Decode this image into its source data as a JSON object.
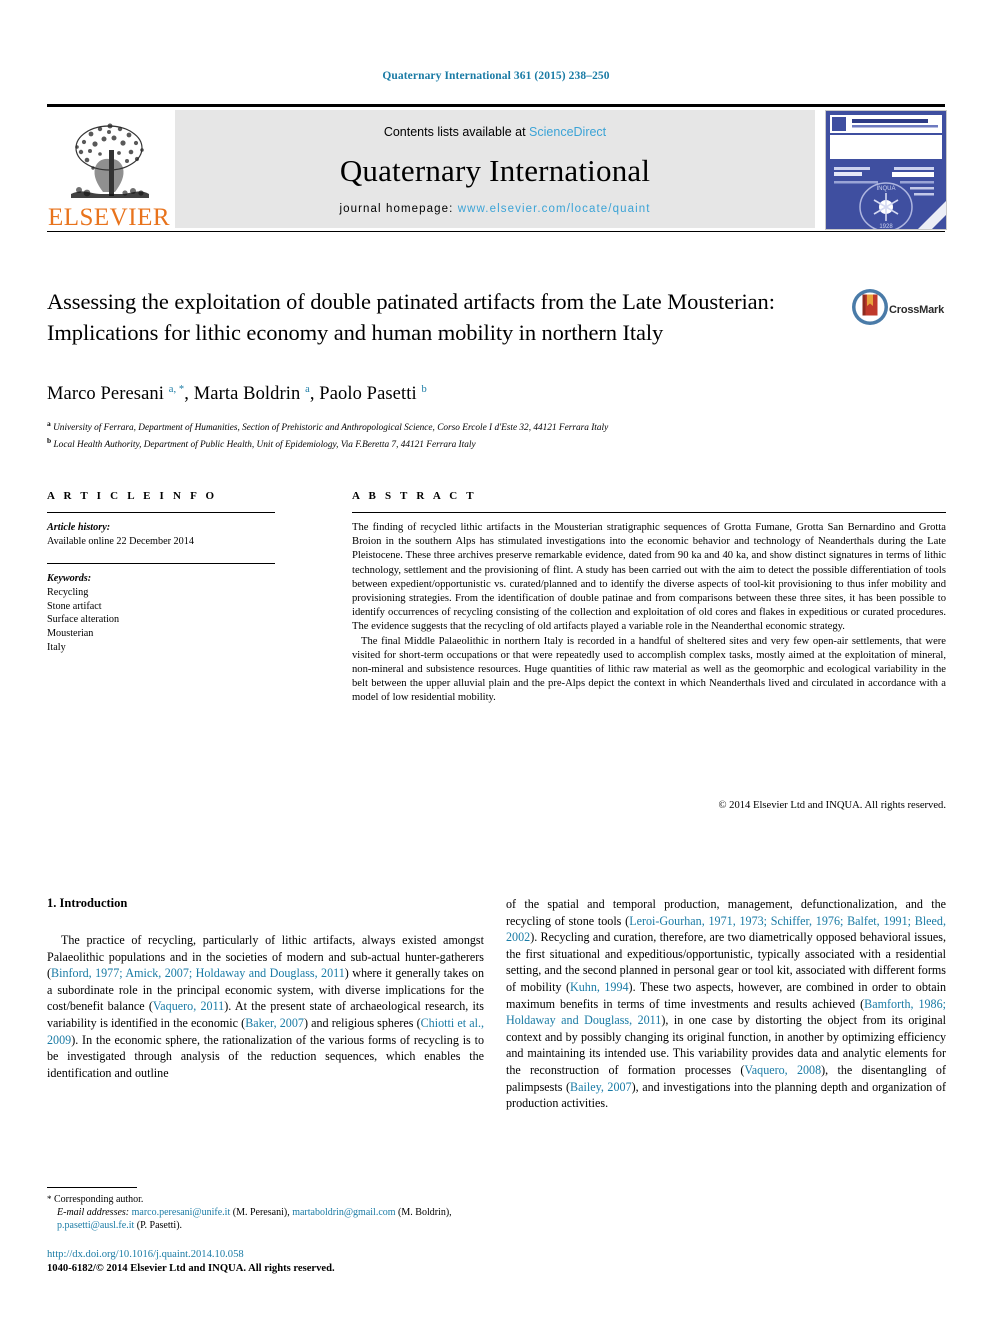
{
  "running_head": "Quaternary International 361 (2015) 238–250",
  "masthead": {
    "contents_prefix": "Contents lists available at ",
    "sciencedirect": "ScienceDirect",
    "journal_title": "Quaternary International",
    "homepage_prefix": "journal homepage: ",
    "homepage_url": "www.elsevier.com/locate/quaint",
    "publisher": "ELSEVIER",
    "accent_blue": "#3ba3d6",
    "elsevier_orange": "#e8731c",
    "cover_blue": "#3f4fa0"
  },
  "article": {
    "title": "Assessing the exploitation of double patinated artifacts from the Late Mousterian: Implications for lithic economy and human mobility in northern Italy",
    "crossmark_label": "CrossMark",
    "authors_html": "Marco Peresani <sup>a,&nbsp;*</sup>, Marta Boldrin <sup>a</sup>, Paolo Pasetti <sup>b</sup>",
    "affiliations": [
      {
        "marker": "a",
        "text": "University of Ferrara, Department of Humanities, Section of Prehistoric and Anthropological Science, Corso Ercole I d'Este 32, 44121 Ferrara Italy"
      },
      {
        "marker": "b",
        "text": "Local Health Authority, Department of Public Health, Unit of Epidemiology, Via F.Beretta 7, 44121 Ferrara Italy"
      }
    ]
  },
  "info": {
    "heading": "A R T I C L E   I N F O",
    "history_label": "Article history:",
    "history_value": "Available online 22 December 2014",
    "keywords_label": "Keywords:",
    "keywords": [
      "Recycling",
      "Stone artifact",
      "Surface alteration",
      "Mousterian",
      "Italy"
    ]
  },
  "abstract": {
    "heading": "A B S T R A C T",
    "paragraphs": [
      "The finding of recycled lithic artifacts in the Mousterian stratigraphic sequences of Grotta Fumane, Grotta San Bernardino and Grotta Broion in the southern Alps has stimulated investigations into the economic behavior and technology of Neanderthals during the Late Pleistocene. These three archives preserve remarkable evidence, dated from 90 ka and 40 ka, and show distinct signatures in terms of lithic technology, settlement and the provisioning of flint. A study has been carried out with the aim to detect the possible differentiation of tools between expedient/opportunistic vs. curated/planned and to identify the diverse aspects of tool-kit provisioning to thus infer mobility and provisioning strategies. From the identification of double patinae and from comparisons between these three sites, it has been possible to identify occurrences of recycling consisting of the collection and exploitation of old cores and flakes in expeditious or curated procedures. The evidence suggests that the recycling of old artifacts played a variable role in the Neanderthal economic strategy.",
      "The final Middle Palaeolithic in northern Italy is recorded in a handful of sheltered sites and very few open-air settlements, that were visited for short-term occupations or that were repeatedly used to accomplish complex tasks, mostly aimed at the exploitation of mineral, non-mineral and subsistence resources. Huge quantities of lithic raw material as well as the geomorphic and ecological variability in the belt between the upper alluvial plain and the pre-Alps depict the context in which Neanderthals lived and circulated in accordance with a model of low residential mobility."
    ],
    "copyright": "© 2014 Elsevier Ltd and INQUA. All rights reserved."
  },
  "body": {
    "section_title": "1. Introduction",
    "left_column_html": "<p>The practice of recycling, particularly of lithic artifacts, always existed amongst Palaeolithic populations and in the societies of modern and sub-actual hunter-gatherers (<span class=\"ref\">Binford, 1977; Amick, 2007; Holdaway and Douglass, 2011</span>) where it generally takes on a subordinate role in the principal economic system, with diverse implications for the cost/benefit balance (<span class=\"ref\">Vaquero, 2011</span>). At the present state of archaeological research, its variability is identified in the economic (<span class=\"ref\">Baker, 2007</span>) and religious spheres (<span class=\"ref\">Chiotti et al., 2009</span>). In the economic sphere, the rationalization of the various forms of recycling is to be investigated through analysis of the reduction sequences, which enables the identification and outline</p>",
    "right_column_html": "<p style=\"text-indent:0\">of the spatial and temporal production, management, defunctionalization, and the recycling of stone tools (<span class=\"ref\">Leroi-Gourhan, 1971, 1973; Schiffer, 1976; Balfet, 1991; Bleed, 2002</span>). Recycling and curation, therefore, are two diametrically opposed behavioral issues, the first situational and expeditious/opportunistic, typically associated with a residential setting, and the second planned in personal gear or tool kit, associated with different forms of mobility (<span class=\"ref\">Kuhn, 1994</span>). These two aspects, however, are combined in order to obtain maximum benefits in terms of time investments and results achieved (<span class=\"ref\">Bamforth, 1986; Holdaway and Douglass, 2011</span>), in one case by distorting the object from its original context and by possibly changing its original function, in another by optimizing efficiency and maintaining its intended use. This variability provides data and analytic elements for the reconstruction of formation processes (<span class=\"ref\">Vaquero, 2008</span>), the disentangling of palimpsests (<span class=\"ref\">Bailey, 2007</span>), and investigations into the planning depth and organization of production activities.</p>"
  },
  "footnotes": {
    "corresponding": "Corresponding author.",
    "email_label": "E-mail addresses:",
    "emails": [
      {
        "address": "marco.peresani@unife.it",
        "owner": "(M. Peresani)"
      },
      {
        "address": "martaboldrin@gmail.com",
        "owner": "(M. Boldrin)"
      },
      {
        "address": "p.pasetti@ausl.fe.it",
        "owner": "(P. Pasetti)"
      }
    ]
  },
  "footer": {
    "doi": "http://dx.doi.org/10.1016/j.quaint.2014.10.058",
    "issn_line": "1040-6182/© 2014 Elsevier Ltd and INQUA. All rights reserved."
  }
}
